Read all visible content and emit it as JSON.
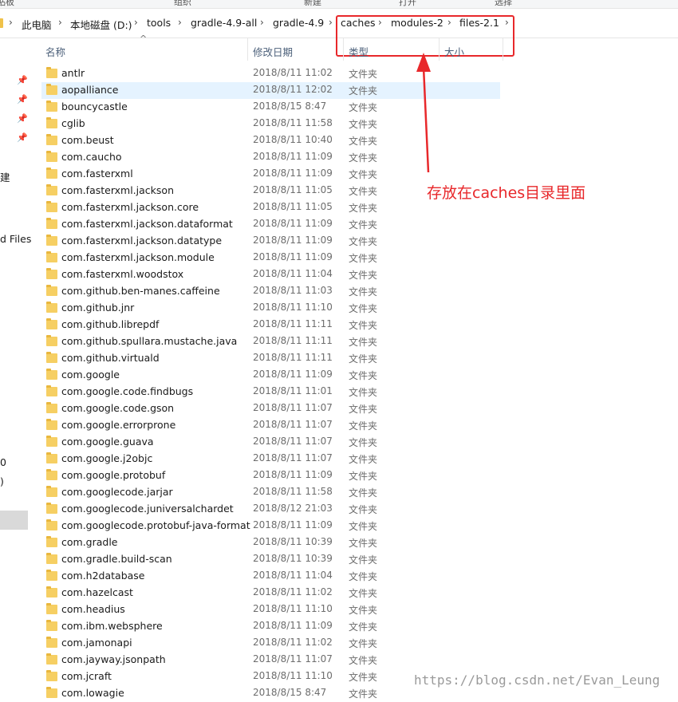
{
  "ribbon": {
    "items": [
      "贴板",
      "组织",
      "新建",
      "打开",
      "选择"
    ]
  },
  "address_bar": {
    "crumbs": [
      "此电脑",
      "本地磁盘 (D:)",
      "tools",
      "gradle-4.9-all",
      "gradle-4.9",
      "caches",
      "modules-2",
      "files-2.1"
    ]
  },
  "nav_pane": {
    "labels": [
      "建",
      "d Files",
      "0",
      ")"
    ]
  },
  "columns": {
    "name": "名称",
    "date": "修改日期",
    "type": "类型",
    "size": "大小"
  },
  "files": [
    {
      "name": "antlr",
      "date": "2018/8/11 11:02",
      "type": "文件夹"
    },
    {
      "name": "aopalliance",
      "date": "2018/8/11 12:02",
      "type": "文件夹"
    },
    {
      "name": "bouncycastle",
      "date": "2018/8/15 8:47",
      "type": "文件夹"
    },
    {
      "name": "cglib",
      "date": "2018/8/11 11:58",
      "type": "文件夹"
    },
    {
      "name": "com.beust",
      "date": "2018/8/11 10:40",
      "type": "文件夹"
    },
    {
      "name": "com.caucho",
      "date": "2018/8/11 11:09",
      "type": "文件夹"
    },
    {
      "name": "com.fasterxml",
      "date": "2018/8/11 11:09",
      "type": "文件夹"
    },
    {
      "name": "com.fasterxml.jackson",
      "date": "2018/8/11 11:05",
      "type": "文件夹"
    },
    {
      "name": "com.fasterxml.jackson.core",
      "date": "2018/8/11 11:05",
      "type": "文件夹"
    },
    {
      "name": "com.fasterxml.jackson.dataformat",
      "date": "2018/8/11 11:09",
      "type": "文件夹"
    },
    {
      "name": "com.fasterxml.jackson.datatype",
      "date": "2018/8/11 11:09",
      "type": "文件夹"
    },
    {
      "name": "com.fasterxml.jackson.module",
      "date": "2018/8/11 11:09",
      "type": "文件夹"
    },
    {
      "name": "com.fasterxml.woodstox",
      "date": "2018/8/11 11:04",
      "type": "文件夹"
    },
    {
      "name": "com.github.ben-manes.caffeine",
      "date": "2018/8/11 11:03",
      "type": "文件夹"
    },
    {
      "name": "com.github.jnr",
      "date": "2018/8/11 11:10",
      "type": "文件夹"
    },
    {
      "name": "com.github.librepdf",
      "date": "2018/8/11 11:11",
      "type": "文件夹"
    },
    {
      "name": "com.github.spullara.mustache.java",
      "date": "2018/8/11 11:11",
      "type": "文件夹"
    },
    {
      "name": "com.github.virtuald",
      "date": "2018/8/11 11:11",
      "type": "文件夹"
    },
    {
      "name": "com.google",
      "date": "2018/8/11 11:09",
      "type": "文件夹"
    },
    {
      "name": "com.google.code.findbugs",
      "date": "2018/8/11 11:01",
      "type": "文件夹"
    },
    {
      "name": "com.google.code.gson",
      "date": "2018/8/11 11:07",
      "type": "文件夹"
    },
    {
      "name": "com.google.errorprone",
      "date": "2018/8/11 11:07",
      "type": "文件夹"
    },
    {
      "name": "com.google.guava",
      "date": "2018/8/11 11:07",
      "type": "文件夹"
    },
    {
      "name": "com.google.j2objc",
      "date": "2018/8/11 11:07",
      "type": "文件夹"
    },
    {
      "name": "com.google.protobuf",
      "date": "2018/8/11 11:09",
      "type": "文件夹"
    },
    {
      "name": "com.googlecode.jarjar",
      "date": "2018/8/11 11:58",
      "type": "文件夹"
    },
    {
      "name": "com.googlecode.juniversalchardet",
      "date": "2018/8/12 21:03",
      "type": "文件夹"
    },
    {
      "name": "com.googlecode.protobuf-java-format",
      "date": "2018/8/11 11:09",
      "type": "文件夹"
    },
    {
      "name": "com.gradle",
      "date": "2018/8/11 10:39",
      "type": "文件夹"
    },
    {
      "name": "com.gradle.build-scan",
      "date": "2018/8/11 10:39",
      "type": "文件夹"
    },
    {
      "name": "com.h2database",
      "date": "2018/8/11 11:04",
      "type": "文件夹"
    },
    {
      "name": "com.hazelcast",
      "date": "2018/8/11 11:02",
      "type": "文件夹"
    },
    {
      "name": "com.headius",
      "date": "2018/8/11 11:10",
      "type": "文件夹"
    },
    {
      "name": "com.ibm.websphere",
      "date": "2018/8/11 11:09",
      "type": "文件夹"
    },
    {
      "name": "com.jamonapi",
      "date": "2018/8/11 11:02",
      "type": "文件夹"
    },
    {
      "name": "com.jayway.jsonpath",
      "date": "2018/8/11 11:07",
      "type": "文件夹"
    },
    {
      "name": "com.jcraft",
      "date": "2018/8/11 11:10",
      "type": "文件夹"
    },
    {
      "name": "com.lowagie",
      "date": "2018/8/15 8:47",
      "type": "文件夹"
    }
  ],
  "annotation": {
    "text": "存放在caches目录里面",
    "color": "#e8282b"
  },
  "watermark": "https://blog.csdn.net/Evan_Leung",
  "colors": {
    "highlight": "#e8282b",
    "selected_row": "#e5f3ff",
    "folder": "#f6cf63"
  }
}
